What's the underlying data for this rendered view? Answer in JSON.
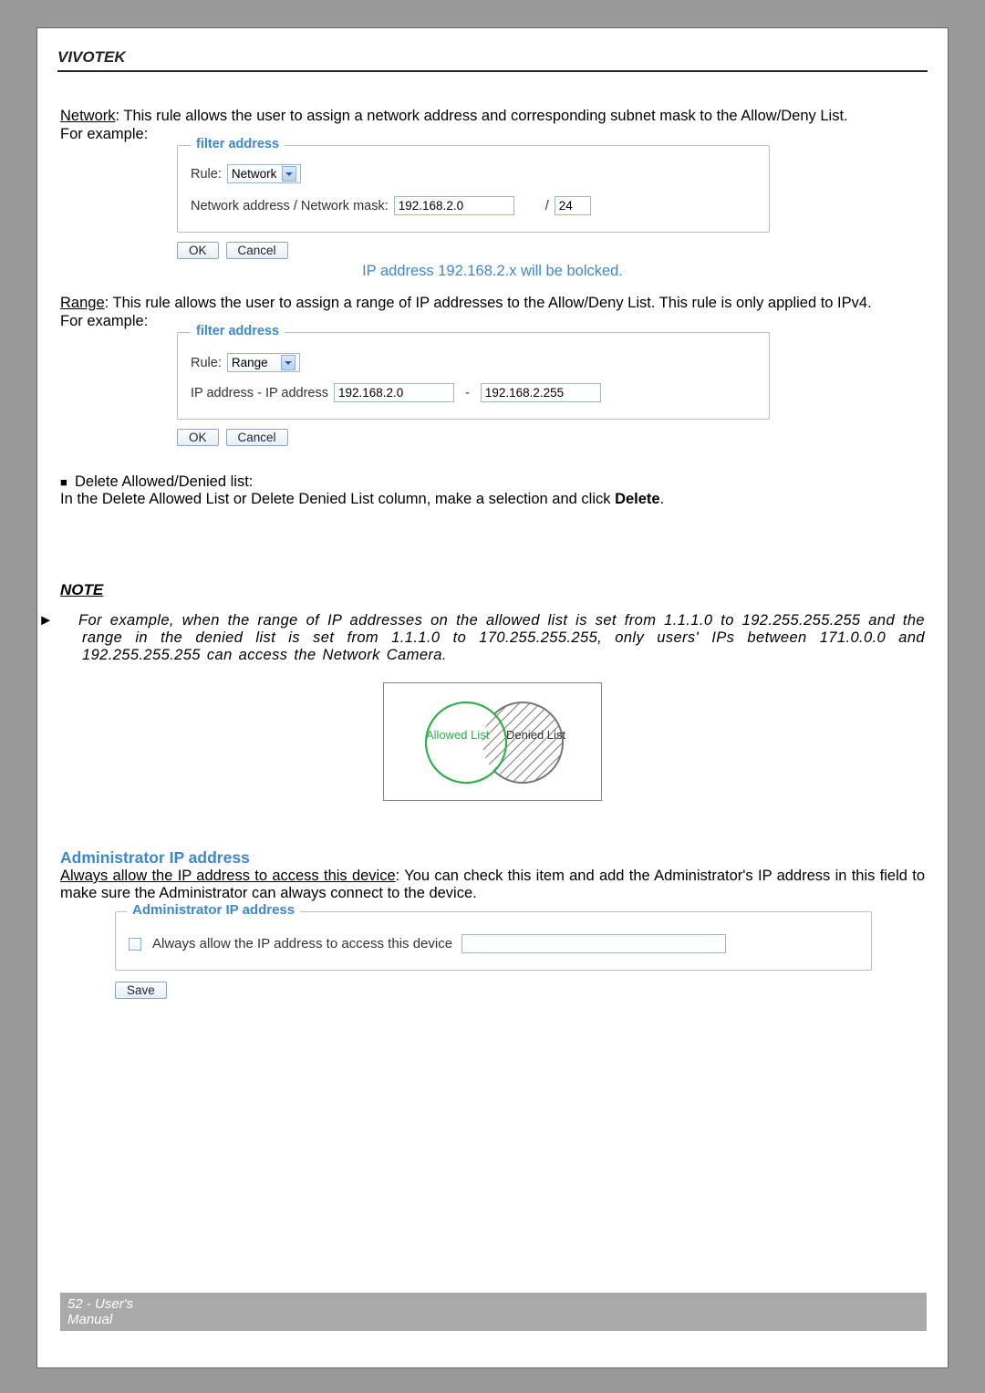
{
  "header": {
    "brand": "VIVOTEK"
  },
  "network_section": {
    "heading_word": "Network",
    "heading_rest": ": This rule allows the user to assign a network address and corresponding subnet mask to the Allow/Deny List.",
    "for_example": "For example:"
  },
  "filter_network": {
    "legend": "filter address",
    "rule_label": "Rule:",
    "rule_value": "Network",
    "field_label": "Network address / Network mask:",
    "addr_value": "192.168.2.0",
    "slash_label": "/",
    "mask_value": "24",
    "ok": "OK",
    "cancel": "Cancel",
    "caption": "IP address 192.168.2.x will be bolcked."
  },
  "range_section": {
    "heading_word": "Range",
    "heading_rest": ": This rule allows the user to assign a range of IP addresses to the Allow/Deny List. This rule is only applied to IPv4.",
    "for_example": "For example:"
  },
  "filter_range": {
    "legend": "filter address",
    "rule_label": "Rule:",
    "rule_value": "Range",
    "field_label": "IP address - IP address",
    "addr1_value": "192.168.2.0",
    "sep_label": "-",
    "addr2_value": "192.168.2.255",
    "ok": "OK",
    "cancel": "Cancel"
  },
  "delete_list": {
    "title": "Delete Allowed/Denied list:",
    "body_a": "In the Delete Allowed List or Delete Denied List column, make a selection and click ",
    "body_bold": "Delete",
    "body_b": "."
  },
  "note": {
    "heading": "NOTE",
    "body": "For example, when the range of IP addresses on the allowed list is set from 1.1.1.0 to 192.255.255.255 and the range in the denied list is set from 1.1.1.0 to 170.255.255.255, only users' IPs between 171.0.0.0 and 192.255.255.255 can access the Network Camera."
  },
  "venn": {
    "allowed": "Allowed List",
    "denied": "Denied List"
  },
  "admin": {
    "section_title": "Administrator IP address",
    "para_u": "Always allow the IP address to access this device",
    "para_rest": ": You can check this item and add the Administrator's IP address in this field to make sure the Administrator can always connect to the device.",
    "legend": "Administrator IP address",
    "checkbox_label": "Always allow the IP address to access this device",
    "ip_value": "",
    "save": "Save"
  },
  "footer": {
    "page": "52 - User's Manual"
  }
}
